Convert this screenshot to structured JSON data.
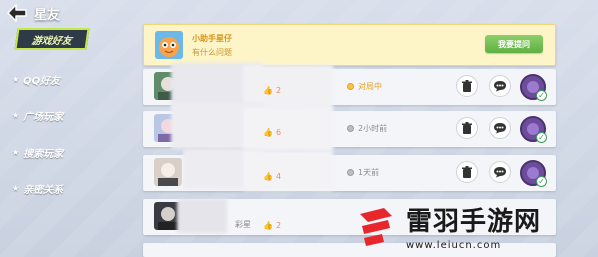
{
  "header": {
    "title": "星友"
  },
  "sidebar": {
    "active_tab": "游戏好友",
    "items": [
      {
        "label": "QQ好友"
      },
      {
        "label": "广场玩家"
      },
      {
        "label": "搜索玩家"
      },
      {
        "label": "亲密关系"
      }
    ]
  },
  "helper": {
    "name": "小助手星仔",
    "subtitle": "有什么问题",
    "ask_label": "我要提问"
  },
  "friends": [
    {
      "likes": "2",
      "status": "对局中",
      "status_type": "online"
    },
    {
      "likes": "6",
      "status": "2小时前",
      "status_type": "offline"
    },
    {
      "likes": "4",
      "status": "1天前",
      "status_type": "offline"
    },
    {
      "likes": "2",
      "partial_name": "彩星"
    }
  ],
  "watermark": {
    "title": "雷羽手游网",
    "url": "www.leiucn.com"
  },
  "colors": {
    "accent_green": "#c5e84a",
    "helper_bg": "#fdf4c8",
    "online": "#e6a21e",
    "offline": "#8c8c96",
    "watermark_red": "#e8272c"
  }
}
